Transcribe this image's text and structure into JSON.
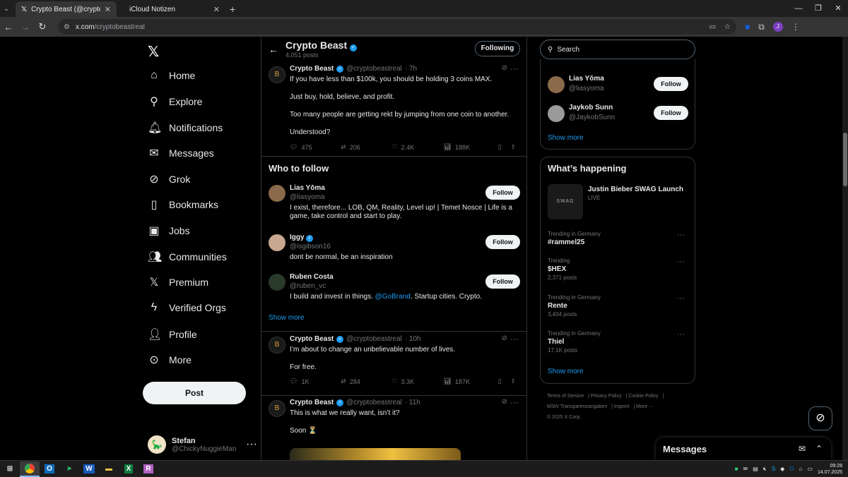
{
  "browser": {
    "tabs": [
      {
        "title": "Crypto Beast (@cryptobeastrea",
        "active": true
      },
      {
        "title": "iCloud Notizen",
        "active": false
      }
    ],
    "url_host": "x.com",
    "url_path": "/cryptobeastreal"
  },
  "nav": {
    "items": [
      {
        "label": "Home",
        "icon": "home-icon"
      },
      {
        "label": "Explore",
        "icon": "search-icon"
      },
      {
        "label": "Notifications",
        "icon": "bell-icon"
      },
      {
        "label": "Messages",
        "icon": "mail-icon"
      },
      {
        "label": "Grok",
        "icon": "grok-icon"
      },
      {
        "label": "Bookmarks",
        "icon": "bookmark-icon"
      },
      {
        "label": "Jobs",
        "icon": "briefcase-icon"
      },
      {
        "label": "Communities",
        "icon": "people-icon"
      },
      {
        "label": "Premium",
        "icon": "x-logo-icon"
      },
      {
        "label": "Verified Orgs",
        "icon": "lightning-icon"
      },
      {
        "label": "Profile",
        "icon": "person-icon"
      },
      {
        "label": "More",
        "icon": "more-circle-icon"
      }
    ],
    "post_label": "Post",
    "me": {
      "name": "Stefan",
      "handle": "@ChickyNuggieMan"
    }
  },
  "profile_header": {
    "name": "Crypto Beast",
    "posts_count": "4,051 posts",
    "following_label": "Following"
  },
  "posts": [
    {
      "name": "Crypto Beast",
      "handle": "@cryptobeastreal",
      "time": "· 7h",
      "lines": [
        "If you have less than $100k, you should be holding 3 coins MAX.",
        "Just buy, hold, believe, and profit.",
        "Too many people are getting rekt by jumping from one coin to another.",
        "Understood?"
      ],
      "replies": "475",
      "reposts": "206",
      "likes": "2.4K",
      "views": "188K"
    },
    {
      "name": "Crypto Beast",
      "handle": "@cryptobeastreal",
      "time": "· 10h",
      "lines": [
        "I’m about to change an unbelievable number of lives.",
        "For free."
      ],
      "replies": "1K",
      "reposts": "284",
      "likes": "3.3K",
      "views": "187K"
    },
    {
      "name": "Crypto Beast",
      "handle": "@cryptobeastreal",
      "time": "· 11h",
      "lines": [
        "This is what we really want, isn’t it?",
        "Soon ⏳"
      ]
    }
  ],
  "who_to_follow": {
    "title": "Who to follow",
    "users": [
      {
        "name": "Lias Yōma",
        "handle": "@liasyoma",
        "bio": "I exist, therefore... LOB, QM, Reality, Level up! | Temet Nosce | Life is a game, take control and start to play.",
        "follow": "Follow"
      },
      {
        "name": "Iggy",
        "handle": "@isgibson16",
        "bio": "dont be normal, be an inspiration",
        "follow": "Follow"
      },
      {
        "name": "Ruben Costa",
        "handle": "@ruben_vc",
        "bio_pre": "I build and invest in things. ",
        "bio_link": "@GoBrand",
        "bio_post": ". Startup cities. Crypto.",
        "follow": "Follow"
      }
    ],
    "show_more": "Show more"
  },
  "right": {
    "search_placeholder": "Search",
    "suggestions": [
      {
        "name": "Lias Yōma",
        "handle": "@liasyoma",
        "follow": "Follow"
      },
      {
        "name": "Jaykob Sunn",
        "handle": "@JaykobSunn",
        "follow": "Follow"
      }
    ],
    "show_more": "Show more",
    "happening": {
      "title": "What’s happening",
      "event_title": "Justin Bieber SWAG Launch",
      "event_status": "LIVE",
      "event_thumb": "SWAG",
      "trends": [
        {
          "context": "Trending in Germany",
          "topic": "#rammel25",
          "posts": ""
        },
        {
          "context": "Trending",
          "topic": "$HEX",
          "posts": "2,371 posts"
        },
        {
          "context": "Trending in Germany",
          "topic": "Rente",
          "posts": "3,404 posts"
        },
        {
          "context": "Trending in Germany",
          "topic": "Thiel",
          "posts": "17.1K posts"
        }
      ],
      "show_more": "Show more"
    },
    "footer": {
      "links": [
        "Terms of Service",
        "Privacy Policy",
        "Cookie Policy",
        "MStV Transparenzangaben",
        "Imprint",
        "More ···"
      ],
      "copyright": "© 2025 X Corp."
    }
  },
  "messages_dock": {
    "title": "Messages"
  },
  "taskbar": {
    "time": "09:28",
    "date": "14.07.2025"
  },
  "colors": {
    "accent": "#1d9bf0",
    "bg": "#000000",
    "border": "#2f3336",
    "muted": "#71767b"
  }
}
